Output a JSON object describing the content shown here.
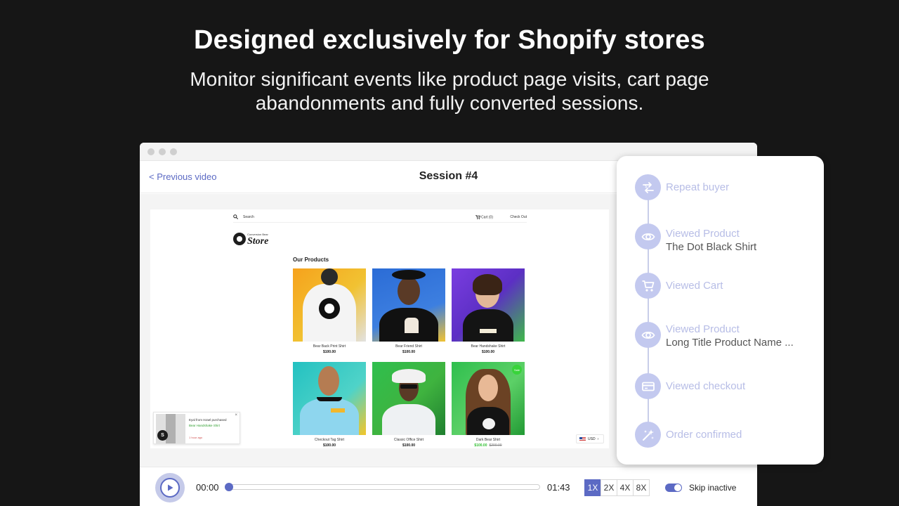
{
  "hero": {
    "title": "Designed exclusively for Shopify stores",
    "subtitle_line1": "Monitor significant events like product page visits, cart page",
    "subtitle_line2": "abandonments and fully converted sessions."
  },
  "session": {
    "previous_label": "< Previous video",
    "title": "Session #4"
  },
  "store": {
    "search_placeholder": "Search",
    "cart_label": "Cart (0)",
    "checkout_label": "Check Out",
    "logo_small": "Conversion Bear",
    "logo_big": "Store",
    "heading": "Our Products",
    "products": [
      {
        "name": "Bear Back Print Shirt",
        "price": "$100.00"
      },
      {
        "name": "Bear Friend Shirt",
        "price": "$100.00"
      },
      {
        "name": "Bear Handshake Shirt",
        "price": "$100.00"
      },
      {
        "name": "Checkout Tag Shirt",
        "price": "$100.00"
      },
      {
        "name": "Classic Office Shirt",
        "price": "$100.00"
      },
      {
        "name": "Dark Bear Shirt",
        "price": "$100.00",
        "old_price": "$200.00",
        "tag": "Sale"
      }
    ],
    "toast": {
      "line1": "Eyal from Israel purchased",
      "line2": "Bear Handshake Shirt",
      "line3": "1 hour ago"
    },
    "currency": "USD"
  },
  "player": {
    "time_start": "00:00",
    "time_end": "01:43",
    "progress": 0,
    "speeds": [
      "1X",
      "2X",
      "4X",
      "8X"
    ],
    "active_speed": "1X",
    "skip_label": "Skip inactive",
    "skip_on": true
  },
  "events": [
    {
      "title": "Repeat buyer",
      "sub": "",
      "icon": "swap-dollar-icon"
    },
    {
      "title": "Viewed Product",
      "sub": "The Dot Black Shirt",
      "icon": "eye-icon"
    },
    {
      "title": "Viewed Cart",
      "sub": "",
      "icon": "cart-icon"
    },
    {
      "title": "Viewed Product",
      "sub": "Long Title Product Name ...",
      "icon": "eye-icon"
    },
    {
      "title": "Viewed checkout",
      "sub": "",
      "icon": "credit-card-icon"
    },
    {
      "title": "Order confirmed",
      "sub": "",
      "icon": "sparkles-icon"
    }
  ],
  "colors": {
    "accent": "#5c6ac4",
    "event_icon_bg": "#c3c9ef",
    "event_title": "#b7bde6"
  }
}
